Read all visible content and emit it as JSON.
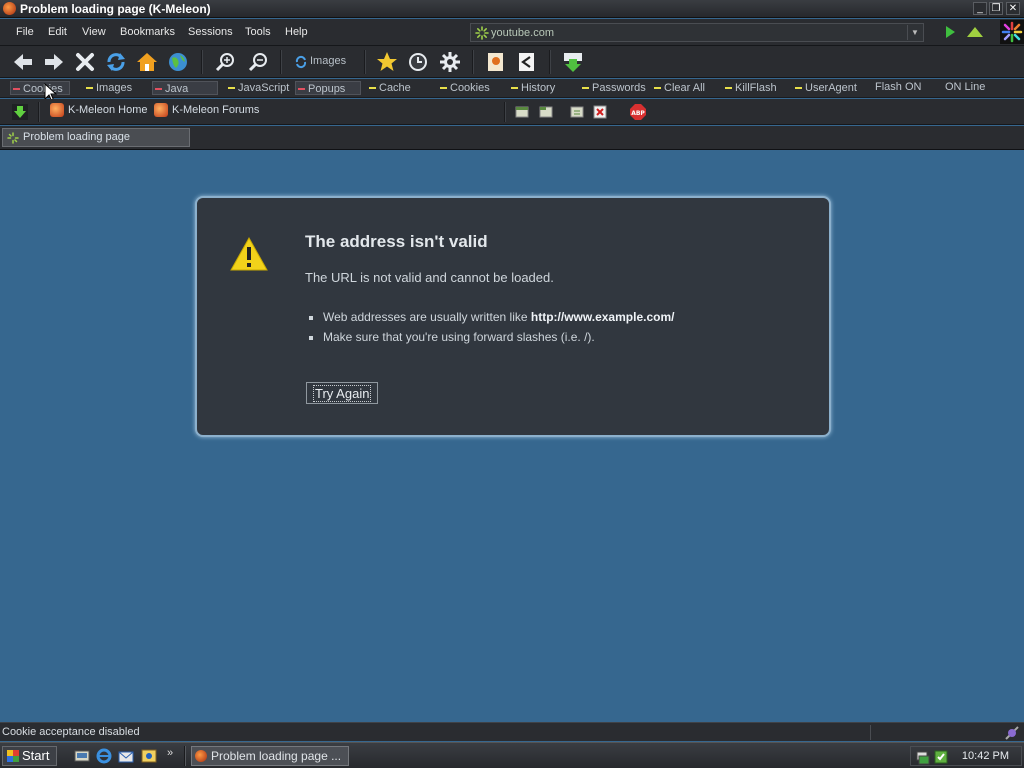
{
  "window": {
    "title": "Problem loading page (K-Meleon)"
  },
  "menu": [
    "File",
    "Edit",
    "View",
    "Bookmarks",
    "Sessions",
    "Tools",
    "Help"
  ],
  "urlbar": {
    "value": "youtube.com"
  },
  "navbar": {
    "images_label": "Images"
  },
  "toggles": [
    {
      "label": "Cookies",
      "state": "off"
    },
    {
      "label": "Images",
      "state": "on"
    },
    {
      "label": "Java",
      "state": "off"
    },
    {
      "label": "JavaScript",
      "state": "on"
    },
    {
      "label": "Popups",
      "state": "off"
    },
    {
      "label": "Cache",
      "state": "on"
    },
    {
      "label": "Cookies",
      "state": "on"
    },
    {
      "label": "History",
      "state": "on"
    },
    {
      "label": "Passwords",
      "state": "on"
    },
    {
      "label": "Clear All",
      "state": "on"
    },
    {
      "label": "KillFlash",
      "state": "on"
    },
    {
      "label": "UserAgent",
      "state": "on"
    },
    {
      "label": "Flash ON",
      "state": "plain"
    },
    {
      "label": "ON Line",
      "state": "plain"
    }
  ],
  "bookmarks": [
    {
      "label": "K-Meleon Home"
    },
    {
      "label": "K-Meleon Forums"
    }
  ],
  "tabs": [
    {
      "label": "Problem loading page"
    }
  ],
  "error": {
    "title": "The address isn't valid",
    "description": "The URL is not valid and cannot be loaded.",
    "bullet1_prefix": "Web addresses are usually written like ",
    "bullet1_example": "http://www.example.com/",
    "bullet2": "Make sure that you're using forward slashes (i.e. /).",
    "button": "Try Again"
  },
  "status": {
    "text": "Cookie acceptance disabled"
  },
  "taskbar": {
    "start": "Start",
    "window_button": "Problem loading page ...",
    "clock": "10:42 PM"
  }
}
